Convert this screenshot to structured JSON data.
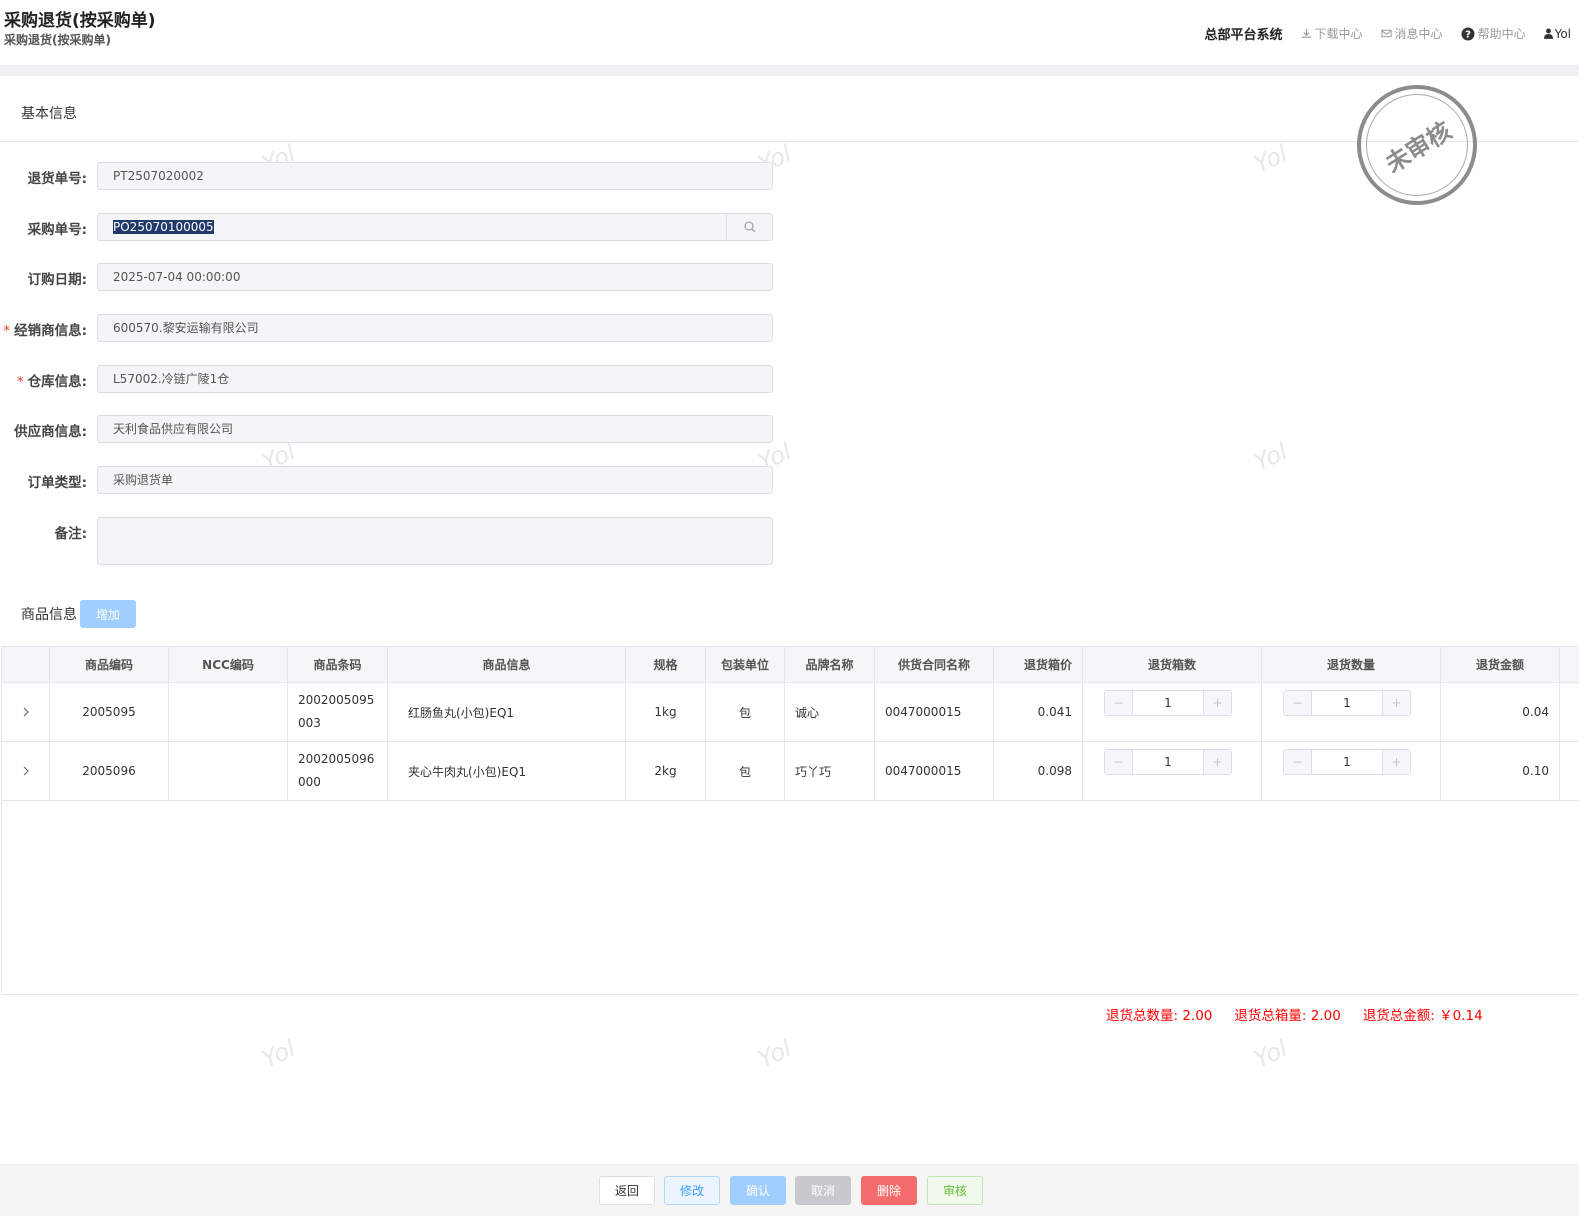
{
  "header": {
    "title": "采购退货(按采购单)",
    "subtitle": "采购退货(按采购单)",
    "system_name": "总部平台系统",
    "download": "下载中心",
    "messages": "消息中心",
    "help": "帮助中心",
    "user": "Yol"
  },
  "basic": {
    "section_title": "基本信息",
    "stamp": "未审核",
    "fields": {
      "return_no": {
        "label": "退货单号:",
        "value": "PT2507020002"
      },
      "po_no": {
        "label": "采购单号:",
        "value": "PO25070100005"
      },
      "order_date": {
        "label": "订购日期:",
        "value": "2025-07-04 00:00:00"
      },
      "dealer": {
        "label": "经销商信息:",
        "value": "600570.黎安运输有限公司",
        "required": true
      },
      "warehouse": {
        "label": "仓库信息:",
        "value": "L57002.冷链广陵1仓",
        "required": true
      },
      "supplier": {
        "label": "供应商信息:",
        "value": "天利食品供应有限公司"
      },
      "order_type": {
        "label": "订单类型:",
        "value": "采购退货单"
      },
      "remark": {
        "label": "备注:",
        "value": ""
      }
    },
    "required_mark": "*"
  },
  "goods": {
    "section_title": "商品信息",
    "add_button": "增加",
    "columns": [
      "商品编码",
      "NCC编码",
      "商品条码",
      "商品信息",
      "规格",
      "包装单位",
      "品牌名称",
      "供货合同名称",
      "退货箱价",
      "退货箱数",
      "退货数量",
      "退货金额"
    ],
    "rows": [
      {
        "code": "2005095",
        "ncc": "",
        "barcode": "2002005095003",
        "info": "红肠鱼丸(小包)EQ1",
        "spec": "1kg",
        "unit": "包",
        "brand": "诚心",
        "contract": "0047000015",
        "box_price": "0.041",
        "boxes": "1",
        "qty": "1",
        "amount": "0.04"
      },
      {
        "code": "2005096",
        "ncc": "",
        "barcode": "2002005096000",
        "info": "夹心牛肉丸(小包)EQ1",
        "spec": "2kg",
        "unit": "包",
        "brand": "巧丫巧",
        "contract": "0047000015",
        "box_price": "0.098",
        "boxes": "1",
        "qty": "1",
        "amount": "0.10"
      }
    ],
    "totals": {
      "qty": "退货总数量: 2.00",
      "boxes": "退货总箱量: 2.00",
      "amount": "退货总金额: ￥0.14"
    }
  },
  "watermark": "Yol",
  "footer": {
    "back": "返回",
    "edit": "修改",
    "confirm": "确认",
    "cancel": "取消",
    "delete": "删除",
    "audit": "审核"
  },
  "colors": {
    "primary_light": "#a0cfff",
    "danger": "#f56c6c",
    "total_text": "#ff0000"
  }
}
